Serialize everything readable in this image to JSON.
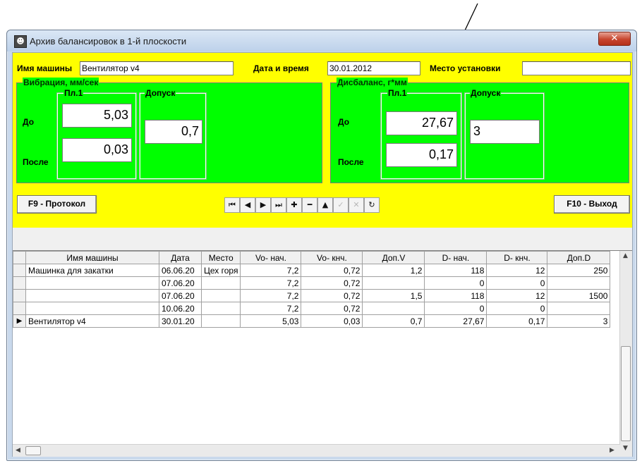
{
  "window": {
    "title": "Архив балансировок в 1-й плоскости",
    "close_glyph": "✕"
  },
  "header": {
    "machine_label": "Имя машины",
    "machine_value": "Вентилятор v4",
    "datetime_label": "Дата и время",
    "datetime_value": "30.01.2012",
    "location_label": "Место установки",
    "location_value": ""
  },
  "vibration": {
    "title": "Вибрация, мм/сек",
    "plane_label": "Пл.1",
    "tolerance_label": "Допуск",
    "before_label": "До",
    "after_label": "После",
    "before_value": "5,03",
    "after_value": "0,03",
    "tolerance_value": "0,7"
  },
  "imbalance": {
    "title": "Дисбаланс, г*мм",
    "plane_label": "Пл.1",
    "tolerance_label": "Допуск",
    "before_label": "До",
    "after_label": "После",
    "before_value": "27,67",
    "after_value": "0,17",
    "tolerance_value": "3"
  },
  "toolbar": {
    "protocol_label": "F9 - Протокол",
    "exit_label": "F10 - Выход",
    "nav": [
      {
        "name": "first-record-button",
        "glyph": "⏮",
        "enabled": true
      },
      {
        "name": "prior-record-button",
        "glyph": "◀",
        "enabled": true
      },
      {
        "name": "next-record-button",
        "glyph": "▶",
        "enabled": true
      },
      {
        "name": "last-record-button",
        "glyph": "⏭",
        "enabled": true
      },
      {
        "name": "insert-record-button",
        "glyph": "✚",
        "enabled": true
      },
      {
        "name": "delete-record-button",
        "glyph": "━",
        "enabled": true
      },
      {
        "name": "edit-record-button",
        "glyph": "▲",
        "enabled": true
      },
      {
        "name": "post-record-button",
        "glyph": "✓",
        "enabled": false
      },
      {
        "name": "cancel-record-button",
        "glyph": "✕",
        "enabled": false
      },
      {
        "name": "refresh-button",
        "glyph": "↻",
        "enabled": true
      }
    ]
  },
  "grid": {
    "columns": [
      "Имя машины",
      "Дата",
      "Место",
      "Vo- нач.",
      "Vo- кнч.",
      "Доп.V",
      "D- нач.",
      "D- кнч.",
      "Доп.D"
    ],
    "rows": [
      {
        "current": false,
        "cells": [
          "Машинка для закатки",
          "06.06.20",
          "Цех горя",
          "7,2",
          "0,72",
          "1,2",
          "118",
          "12",
          "250"
        ]
      },
      {
        "current": false,
        "cells": [
          "",
          "07.06.20",
          "",
          "7,2",
          "0,72",
          "",
          "0",
          "0",
          ""
        ]
      },
      {
        "current": false,
        "cells": [
          "",
          "07.06.20",
          "",
          "7,2",
          "0,72",
          "1,5",
          "118",
          "12",
          "1500"
        ]
      },
      {
        "current": false,
        "cells": [
          "",
          "10.06.20",
          "",
          "7,2",
          "0,72",
          "",
          "0",
          "0",
          ""
        ]
      },
      {
        "current": true,
        "cells": [
          "Вентилятор v4",
          "30.01.20",
          "",
          "5,03",
          "0,03",
          "0,7",
          "27,67",
          "0,17",
          "3"
        ]
      }
    ]
  }
}
